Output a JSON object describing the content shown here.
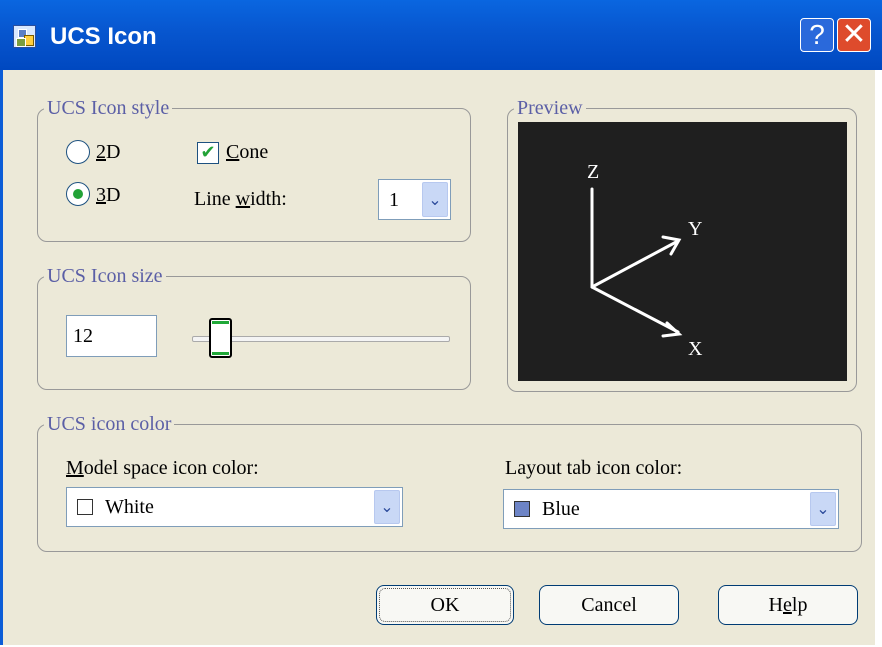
{
  "window": {
    "title": "UCS Icon"
  },
  "titlebar": {
    "help_label": "?",
    "close_label": "✕"
  },
  "style_group": {
    "title": "UCS Icon style",
    "radio_2d": {
      "label_u": "2",
      "label_rest": "D",
      "checked": false
    },
    "radio_3d": {
      "label_u": "3",
      "label_rest": "D",
      "checked": true
    },
    "cone": {
      "label_u": "C",
      "label_rest": "one",
      "checked": true
    },
    "line_width": {
      "label_pre": "Line ",
      "label_u": "w",
      "label_post": "idth:",
      "value": "1"
    }
  },
  "preview": {
    "title": "Preview",
    "axis_z": "Z",
    "axis_y": "Y",
    "axis_x": "X"
  },
  "size_group": {
    "title": "UCS Icon size",
    "value": "12"
  },
  "color_group": {
    "title": "UCS icon color",
    "model_label_u": "M",
    "model_label_rest": "odel space icon color:",
    "model_value": "White",
    "model_swatch": "#ffffff",
    "layout_label": "Layout tab icon color:",
    "layout_value": "Blue",
    "layout_swatch": "#6d84c6"
  },
  "buttons": {
    "ok": "OK",
    "cancel": "Cancel",
    "help_pre": "H",
    "help_u": "e",
    "help_post": "lp"
  },
  "colors": {
    "titlebar": "#0756cf",
    "dialog_bg": "#ece9d8",
    "accent_green": "#22a237",
    "group_title": "#5b5fa6"
  }
}
